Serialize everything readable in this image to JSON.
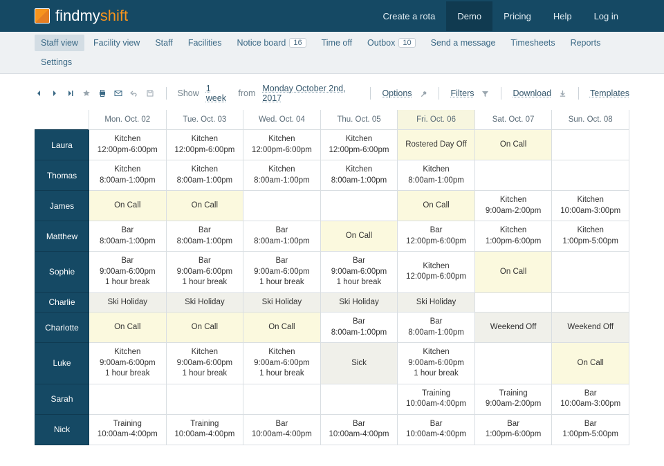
{
  "brand": {
    "prefix": "findmy",
    "suffix": "shift"
  },
  "topnav": {
    "create": "Create a rota",
    "demo": "Demo",
    "pricing": "Pricing",
    "help": "Help",
    "login": "Log in"
  },
  "menubar": {
    "staff_view": "Staff view",
    "facility_view": "Facility view",
    "staff": "Staff",
    "facilities": "Facilities",
    "notice_board": "Notice board",
    "notice_count": "16",
    "time_off": "Time off",
    "outbox": "Outbox",
    "outbox_count": "10",
    "send_message": "Send a message",
    "timesheets": "Timesheets",
    "reports": "Reports",
    "settings": "Settings"
  },
  "toolbar": {
    "show": "Show",
    "range": "1 week",
    "from": "from",
    "date": "Monday October 2nd, 2017",
    "options": "Options",
    "filters": "Filters",
    "download": "Download",
    "templates": "Templates"
  },
  "days": [
    "Mon. Oct. 02",
    "Tue. Oct. 03",
    "Wed. Oct. 04",
    "Thu. Oct. 05",
    "Fri. Oct. 06",
    "Sat. Oct. 07",
    "Sun. Oct. 08"
  ],
  "today_index": 4,
  "staff": [
    "Laura",
    "Thomas",
    "James",
    "Matthew",
    "Sophie",
    "Charlie",
    "Charlotte",
    "Luke",
    "Sarah",
    "Nick"
  ],
  "rows": [
    [
      {
        "l": [
          "Kitchen",
          "12:00pm-6:00pm"
        ],
        "c": ""
      },
      {
        "l": [
          "Kitchen",
          "12:00pm-6:00pm"
        ],
        "c": ""
      },
      {
        "l": [
          "Kitchen",
          "12:00pm-6:00pm"
        ],
        "c": ""
      },
      {
        "l": [
          "Kitchen",
          "12:00pm-6:00pm"
        ],
        "c": ""
      },
      {
        "l": [
          "Rostered Day Off"
        ],
        "c": "yellow"
      },
      {
        "l": [
          "On Call"
        ],
        "c": "yellow"
      },
      {
        "l": [],
        "c": ""
      }
    ],
    [
      {
        "l": [
          "Kitchen",
          "8:00am-1:00pm"
        ],
        "c": ""
      },
      {
        "l": [
          "Kitchen",
          "8:00am-1:00pm"
        ],
        "c": ""
      },
      {
        "l": [
          "Kitchen",
          "8:00am-1:00pm"
        ],
        "c": ""
      },
      {
        "l": [
          "Kitchen",
          "8:00am-1:00pm"
        ],
        "c": ""
      },
      {
        "l": [
          "Kitchen",
          "8:00am-1:00pm"
        ],
        "c": ""
      },
      {
        "l": [],
        "c": ""
      },
      {
        "l": [],
        "c": ""
      }
    ],
    [
      {
        "l": [
          "On Call"
        ],
        "c": "yellow"
      },
      {
        "l": [
          "On Call"
        ],
        "c": "yellow"
      },
      {
        "l": [],
        "c": ""
      },
      {
        "l": [],
        "c": ""
      },
      {
        "l": [
          "On Call"
        ],
        "c": "yellow"
      },
      {
        "l": [
          "Kitchen",
          "9:00am-2:00pm"
        ],
        "c": ""
      },
      {
        "l": [
          "Kitchen",
          "10:00am-3:00pm"
        ],
        "c": ""
      }
    ],
    [
      {
        "l": [
          "Bar",
          "8:00am-1:00pm"
        ],
        "c": ""
      },
      {
        "l": [
          "Bar",
          "8:00am-1:00pm"
        ],
        "c": ""
      },
      {
        "l": [
          "Bar",
          "8:00am-1:00pm"
        ],
        "c": ""
      },
      {
        "l": [
          "On Call"
        ],
        "c": "yellow"
      },
      {
        "l": [
          "Bar",
          "12:00pm-6:00pm"
        ],
        "c": ""
      },
      {
        "l": [
          "Kitchen",
          "1:00pm-6:00pm"
        ],
        "c": ""
      },
      {
        "l": [
          "Kitchen",
          "1:00pm-5:00pm"
        ],
        "c": ""
      }
    ],
    [
      {
        "l": [
          "Bar",
          "9:00am-6:00pm",
          "1 hour break"
        ],
        "c": ""
      },
      {
        "l": [
          "Bar",
          "9:00am-6:00pm",
          "1 hour break"
        ],
        "c": ""
      },
      {
        "l": [
          "Bar",
          "9:00am-6:00pm",
          "1 hour break"
        ],
        "c": ""
      },
      {
        "l": [
          "Bar",
          "9:00am-6:00pm",
          "1 hour break"
        ],
        "c": ""
      },
      {
        "l": [
          "Kitchen",
          "12:00pm-6:00pm"
        ],
        "c": ""
      },
      {
        "l": [
          "On Call"
        ],
        "c": "yellow"
      },
      {
        "l": [],
        "c": ""
      }
    ],
    [
      {
        "l": [
          "Ski Holiday"
        ],
        "c": "grey"
      },
      {
        "l": [
          "Ski Holiday"
        ],
        "c": "grey"
      },
      {
        "l": [
          "Ski Holiday"
        ],
        "c": "grey"
      },
      {
        "l": [
          "Ski Holiday"
        ],
        "c": "grey"
      },
      {
        "l": [
          "Ski Holiday"
        ],
        "c": "grey"
      },
      {
        "l": [],
        "c": ""
      },
      {
        "l": [],
        "c": ""
      }
    ],
    [
      {
        "l": [
          "On Call"
        ],
        "c": "yellow"
      },
      {
        "l": [
          "On Call"
        ],
        "c": "yellow"
      },
      {
        "l": [
          "On Call"
        ],
        "c": "yellow"
      },
      {
        "l": [
          "Bar",
          "8:00am-1:00pm"
        ],
        "c": ""
      },
      {
        "l": [
          "Bar",
          "8:00am-1:00pm"
        ],
        "c": ""
      },
      {
        "l": [
          "Weekend Off"
        ],
        "c": "grey"
      },
      {
        "l": [
          "Weekend Off"
        ],
        "c": "grey"
      }
    ],
    [
      {
        "l": [
          "Kitchen",
          "9:00am-6:00pm",
          "1 hour break"
        ],
        "c": ""
      },
      {
        "l": [
          "Kitchen",
          "9:00am-6:00pm",
          "1 hour break"
        ],
        "c": ""
      },
      {
        "l": [
          "Kitchen",
          "9:00am-6:00pm",
          "1 hour break"
        ],
        "c": ""
      },
      {
        "l": [
          "Sick"
        ],
        "c": "grey"
      },
      {
        "l": [
          "Kitchen",
          "9:00am-6:00pm",
          "1 hour break"
        ],
        "c": ""
      },
      {
        "l": [],
        "c": ""
      },
      {
        "l": [
          "On Call"
        ],
        "c": "yellow"
      }
    ],
    [
      {
        "l": [],
        "c": ""
      },
      {
        "l": [],
        "c": ""
      },
      {
        "l": [],
        "c": ""
      },
      {
        "l": [],
        "c": ""
      },
      {
        "l": [
          "Training",
          "10:00am-4:00pm"
        ],
        "c": ""
      },
      {
        "l": [
          "Training",
          "9:00am-2:00pm"
        ],
        "c": ""
      },
      {
        "l": [
          "Bar",
          "10:00am-3:00pm"
        ],
        "c": ""
      }
    ],
    [
      {
        "l": [
          "Training",
          "10:00am-4:00pm"
        ],
        "c": ""
      },
      {
        "l": [
          "Training",
          "10:00am-4:00pm"
        ],
        "c": ""
      },
      {
        "l": [
          "Bar",
          "10:00am-4:00pm"
        ],
        "c": ""
      },
      {
        "l": [
          "Bar",
          "10:00am-4:00pm"
        ],
        "c": ""
      },
      {
        "l": [
          "Bar",
          "10:00am-4:00pm"
        ],
        "c": ""
      },
      {
        "l": [
          "Bar",
          "1:00pm-6:00pm"
        ],
        "c": ""
      },
      {
        "l": [
          "Bar",
          "1:00pm-5:00pm"
        ],
        "c": ""
      }
    ]
  ]
}
